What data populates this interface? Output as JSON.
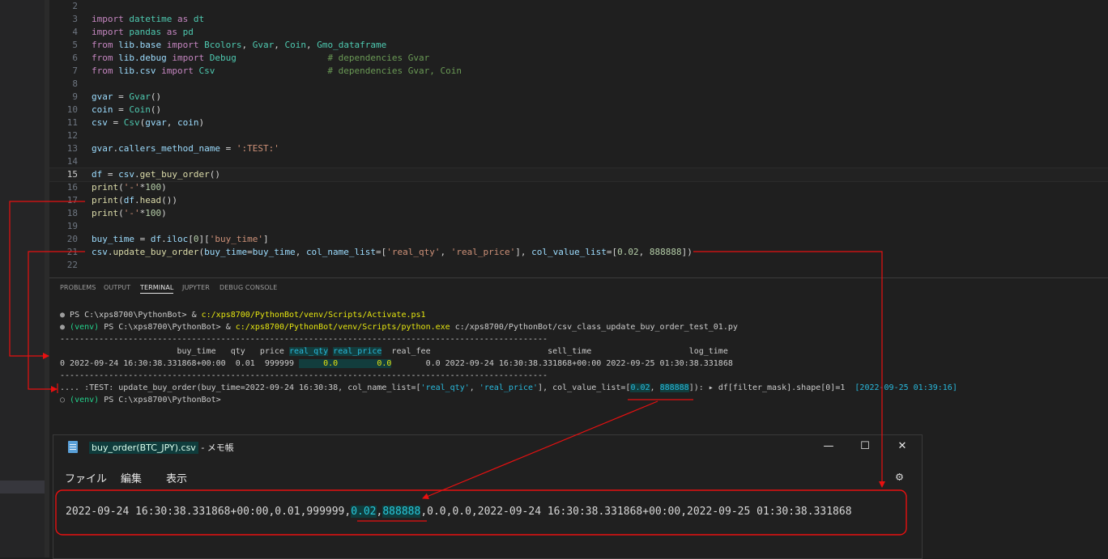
{
  "editor": {
    "lines": [
      {
        "n": "2",
        "parts": []
      },
      {
        "n": "3",
        "parts": [
          [
            "kw",
            "import "
          ],
          [
            "cls",
            "datetime"
          ],
          [
            "kw",
            " as "
          ],
          [
            "cls",
            "dt"
          ]
        ]
      },
      {
        "n": "4",
        "parts": [
          [
            "kw",
            "import "
          ],
          [
            "cls",
            "pandas"
          ],
          [
            "kw",
            " as "
          ],
          [
            "cls",
            "pd"
          ]
        ]
      },
      {
        "n": "5",
        "parts": [
          [
            "kw",
            "from "
          ],
          [
            "var",
            "lib.base"
          ],
          [
            "kw",
            " import "
          ],
          [
            "cls",
            "Bcolors"
          ],
          [
            "pl",
            ", "
          ],
          [
            "cls",
            "Gvar"
          ],
          [
            "pl",
            ", "
          ],
          [
            "cls",
            "Coin"
          ],
          [
            "pl",
            ", "
          ],
          [
            "cls",
            "Gmo_dataframe"
          ]
        ]
      },
      {
        "n": "6",
        "parts": [
          [
            "kw",
            "from "
          ],
          [
            "var",
            "lib.debug"
          ],
          [
            "kw",
            " import "
          ],
          [
            "cls",
            "Debug"
          ],
          [
            "pl",
            "                 "
          ],
          [
            "cm",
            "# dependencies Gvar"
          ]
        ]
      },
      {
        "n": "7",
        "parts": [
          [
            "kw",
            "from "
          ],
          [
            "var",
            "lib.csv"
          ],
          [
            "kw",
            " import "
          ],
          [
            "cls",
            "Csv"
          ],
          [
            "pl",
            "                     "
          ],
          [
            "cm",
            "# dependencies Gvar, Coin"
          ]
        ]
      },
      {
        "n": "8",
        "parts": []
      },
      {
        "n": "9",
        "parts": [
          [
            "var",
            "gvar"
          ],
          [
            "pl",
            " = "
          ],
          [
            "cls",
            "Gvar"
          ],
          [
            "pl",
            "()"
          ]
        ]
      },
      {
        "n": "10",
        "parts": [
          [
            "var",
            "coin"
          ],
          [
            "pl",
            " = "
          ],
          [
            "cls",
            "Coin"
          ],
          [
            "pl",
            "()"
          ]
        ]
      },
      {
        "n": "11",
        "parts": [
          [
            "var",
            "csv"
          ],
          [
            "pl",
            " = "
          ],
          [
            "cls",
            "Csv"
          ],
          [
            "pl",
            "("
          ],
          [
            "var",
            "gvar"
          ],
          [
            "pl",
            ", "
          ],
          [
            "var",
            "coin"
          ],
          [
            "pl",
            ")"
          ]
        ]
      },
      {
        "n": "12",
        "parts": []
      },
      {
        "n": "13",
        "parts": [
          [
            "var",
            "gvar"
          ],
          [
            "pl",
            "."
          ],
          [
            "var",
            "callers_method_name"
          ],
          [
            "pl",
            " = "
          ],
          [
            "str",
            "':TEST:'"
          ]
        ]
      },
      {
        "n": "14",
        "parts": []
      },
      {
        "n": "15",
        "cur": true,
        "parts": [
          [
            "var",
            "df"
          ],
          [
            "pl",
            " = "
          ],
          [
            "var",
            "csv"
          ],
          [
            "pl",
            "."
          ],
          [
            "fn",
            "get_buy_order"
          ],
          [
            "pl",
            "()"
          ]
        ]
      },
      {
        "n": "16",
        "parts": [
          [
            "fn",
            "print"
          ],
          [
            "pl",
            "("
          ],
          [
            "str",
            "'-'"
          ],
          [
            "pl",
            "*"
          ],
          [
            "num",
            "100"
          ],
          [
            "pl",
            ")"
          ]
        ]
      },
      {
        "n": "17",
        "parts": [
          [
            "fn",
            "print"
          ],
          [
            "pl",
            "("
          ],
          [
            "var",
            "df"
          ],
          [
            "pl",
            "."
          ],
          [
            "fn",
            "head"
          ],
          [
            "pl",
            "())"
          ]
        ]
      },
      {
        "n": "18",
        "parts": [
          [
            "fn",
            "print"
          ],
          [
            "pl",
            "("
          ],
          [
            "str",
            "'-'"
          ],
          [
            "pl",
            "*"
          ],
          [
            "num",
            "100"
          ],
          [
            "pl",
            ")"
          ]
        ]
      },
      {
        "n": "19",
        "parts": []
      },
      {
        "n": "20",
        "parts": [
          [
            "var",
            "buy_time"
          ],
          [
            "pl",
            " = "
          ],
          [
            "var",
            "df"
          ],
          [
            "pl",
            "."
          ],
          [
            "var",
            "iloc"
          ],
          [
            "pl",
            "["
          ],
          [
            "num",
            "0"
          ],
          [
            "pl",
            "]["
          ],
          [
            "str",
            "'buy_time'"
          ],
          [
            "pl",
            "]"
          ]
        ]
      },
      {
        "n": "21",
        "parts": [
          [
            "var",
            "csv"
          ],
          [
            "pl",
            "."
          ],
          [
            "fn",
            "update_buy_order"
          ],
          [
            "pl",
            "("
          ],
          [
            "var",
            "buy_time"
          ],
          [
            "pl",
            "="
          ],
          [
            "var",
            "buy_time"
          ],
          [
            "pl",
            ", "
          ],
          [
            "var",
            "col_name_list"
          ],
          [
            "pl",
            "=["
          ],
          [
            "str",
            "'real_qty'"
          ],
          [
            "pl",
            ", "
          ],
          [
            "str",
            "'real_price'"
          ],
          [
            "pl",
            "], "
          ],
          [
            "var",
            "col_value_list"
          ],
          [
            "pl",
            "=["
          ],
          [
            "num",
            "0.02"
          ],
          [
            "pl",
            ", "
          ],
          [
            "num",
            "888888"
          ],
          [
            "pl",
            "])"
          ]
        ]
      },
      {
        "n": "22",
        "parts": []
      }
    ]
  },
  "panel": {
    "tabs": [
      "PROBLEMS",
      "OUTPUT",
      "TERMINAL",
      "JUPYTER",
      "DEBUG CONSOLE"
    ],
    "active_tab": "TERMINAL"
  },
  "terminal": {
    "line1_prompt": "PS C:\\xps8700\\PythonBot> ",
    "line1_amp": "& ",
    "line1_path": "c:/xps8700/PythonBot/venv/Scripts/Activate.ps1",
    "line2_venv": "(venv)",
    "line2_prompt": " PS C:\\xps8700\\PythonBot> ",
    "line2_amp": "& ",
    "line2_exe": "c:/xps8700/PythonBot/venv/Scripts/python.exe",
    "line2_script": " c:/xps8700/PythonBot/csv_class_update_buy_order_test_01.py",
    "dash_line": "----------------------------------------------------------------------------------------------------",
    "header_pre": "                        buy_time   qty   price ",
    "header_real_qty": "real_qty",
    "header_sep": " ",
    "header_real_price": "real_price",
    "header_post": "  real_fee                        sell_time                    log_time",
    "row_pre": "0 2022-09-24 16:30:38.331868+00:00  0.01  999999 ",
    "row_real_qty": "     0.0 ",
    "row_real_price": "       0.0",
    "row_post": "       0.0 2022-09-24 16:30:38.331868+00:00 2022-09-25 01:30:38.331868",
    "log_pre": ".... :TEST: update_buy_order(buy_time=2022-09-24 16:30:38, col_name_list=[",
    "log_rq": "'real_qty'",
    "log_sep1": ", ",
    "log_rp": "'real_price'",
    "log_mid": "], col_value_list=[",
    "log_v1": "0.02",
    "log_sep2": ", ",
    "log_v2": "888888",
    "log_post": "]): ▸ df[filter_mask].shape[0]=1  ",
    "log_time": "[2022-09-25 01:39:16]",
    "last_venv": "(venv)",
    "last_prompt": " PS C:\\xps8700\\PythonBot>"
  },
  "notepad": {
    "file_name": "buy_order(BTC_JPY).csv",
    "app_suffix": " - メモ帳",
    "menu": [
      "ファイル",
      "編集",
      "表示"
    ],
    "text_pre": "2022-09-24 16:30:38.331868+00:00,0.01,999999,",
    "text_v1": "0.02",
    "text_comma": ",",
    "text_v2": "888888",
    "text_post": ",0.0,0.0,2022-09-24 16:30:38.331868+00:00,2022-09-25 01:30:38.331868"
  },
  "colors": {
    "annotation": "#e81010",
    "background": "#1f1f1f"
  }
}
